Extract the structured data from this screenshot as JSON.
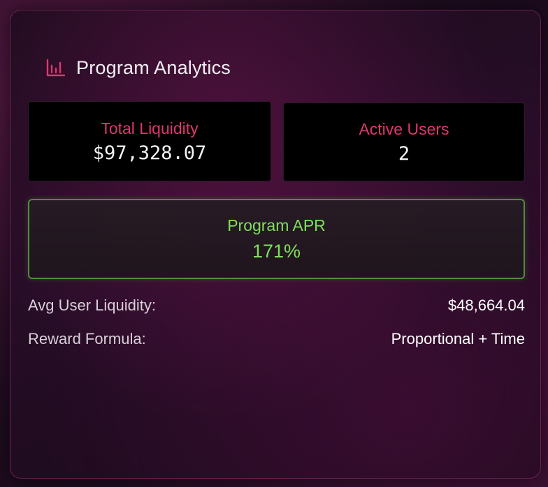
{
  "header": {
    "icon": "bar-chart-icon",
    "title": "Program Analytics"
  },
  "stats": {
    "liquidity": {
      "label": "Total Liquidity",
      "value": "$97,328.07"
    },
    "users": {
      "label": "Active Users",
      "value": "2"
    }
  },
  "apr": {
    "label": "Program APR",
    "value": "171%"
  },
  "details": [
    {
      "label": "Avg User Liquidity:",
      "value": "$48,664.04"
    },
    {
      "label": "Reward Formula:",
      "value": "Proportional + Time"
    }
  ],
  "colors": {
    "accent_pink": "#e0366d",
    "accent_green": "#7ee05a",
    "card_border": "#be3c8c"
  }
}
